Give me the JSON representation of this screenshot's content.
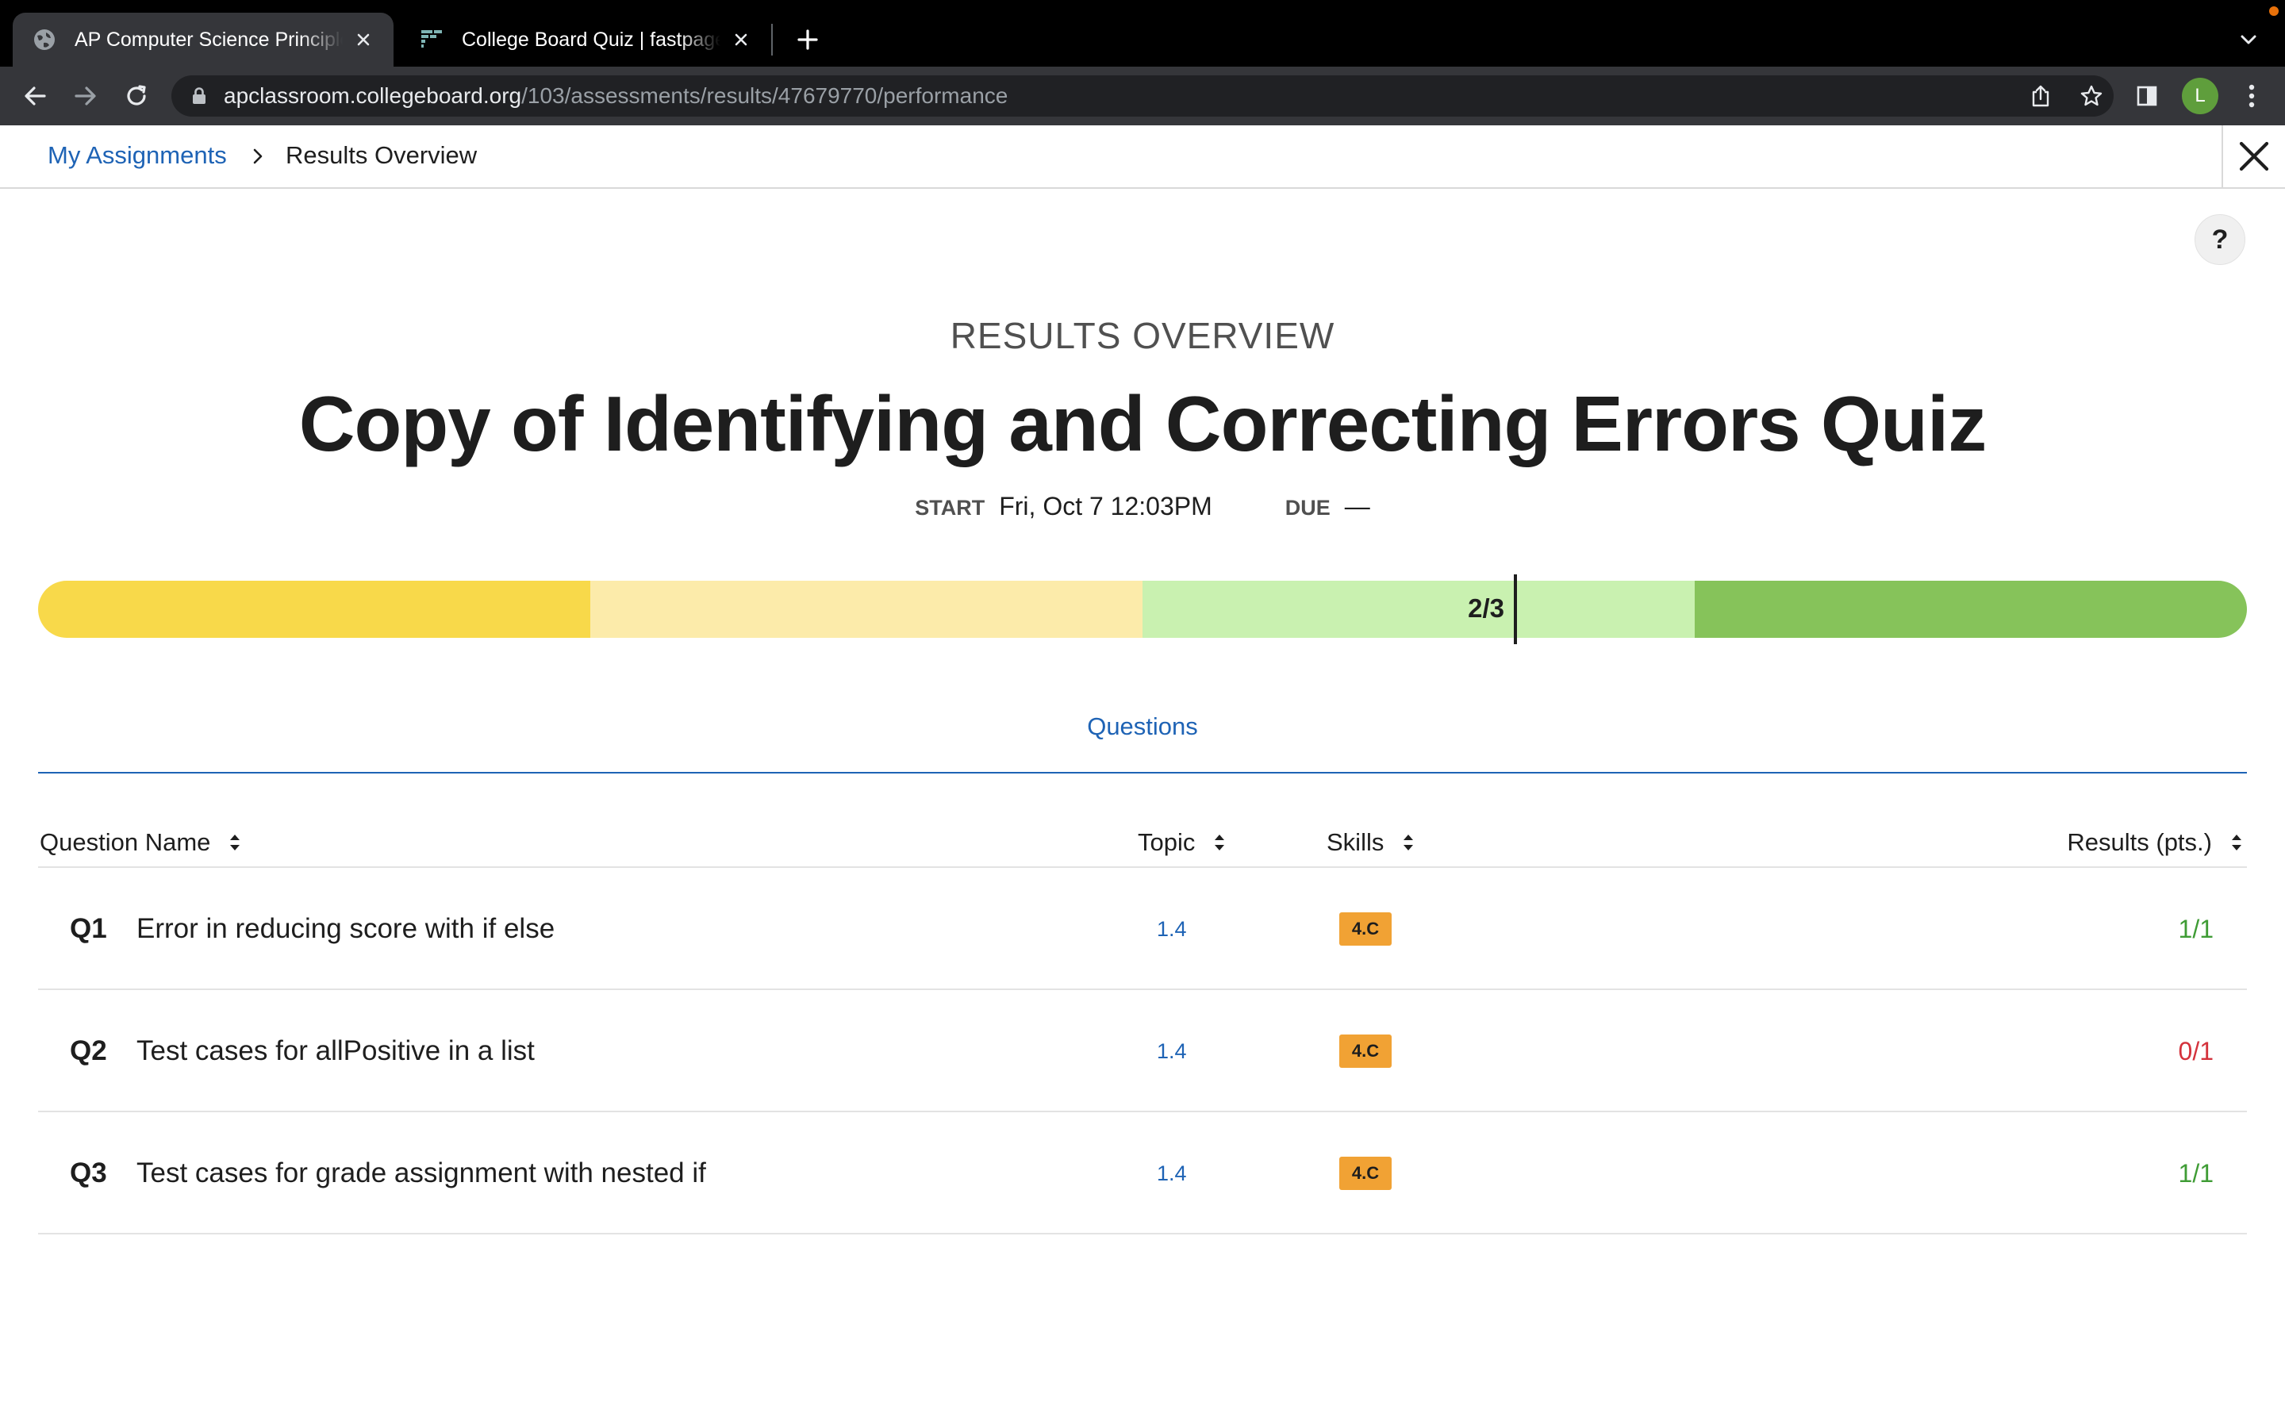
{
  "browser": {
    "tabs": [
      {
        "title": "AP Computer Science Principles",
        "active": true,
        "icon": "globe-icon"
      },
      {
        "title": "College Board Quiz | fastpages",
        "active": false,
        "icon": "fastpages-icon"
      }
    ],
    "url_host": "apclassroom.collegeboard.org",
    "url_path": "/103/assessments/results/47679770/performance",
    "profile_initial": "L",
    "profile_color": "#5f9e3c"
  },
  "breadcrumb": {
    "parent": "My Assignments",
    "current": "Results Overview"
  },
  "help_label": "?",
  "header": {
    "eyebrow": "RESULTS OVERVIEW",
    "title": "Copy of Identifying and Correcting Errors Quiz",
    "start_label": "START",
    "start_value": "Fri, Oct 7 12:03PM",
    "due_label": "DUE",
    "due_value": "—"
  },
  "progress": {
    "score_label": "2/3",
    "score_fraction": 0.667,
    "segment_colors": [
      "#f8d94a",
      "#fcebaa",
      "#c9f1b0",
      "#c9f1b0",
      "#86c35a"
    ]
  },
  "questions_tab": "Questions",
  "table": {
    "headers": {
      "name": "Question Name",
      "topic": "Topic",
      "skills": "Skills",
      "results": "Results (pts.)"
    },
    "rows": [
      {
        "num": "Q1",
        "name": "Error in reducing score with if else",
        "topic": "1.4",
        "skill": "4.C",
        "result": "1/1",
        "result_color": "#3f9c35"
      },
      {
        "num": "Q2",
        "name": "Test cases for allPositive in a list",
        "topic": "1.4",
        "skill": "4.C",
        "result": "0/1",
        "result_color": "#d4323c"
      },
      {
        "num": "Q3",
        "name": "Test cases for grade assignment with nested if",
        "topic": "1.4",
        "skill": "4.C",
        "result": "1/1",
        "result_color": "#3f9c35"
      }
    ]
  },
  "colors": {
    "link_blue": "#1e63b5",
    "skill_badge": "#f1a234"
  }
}
